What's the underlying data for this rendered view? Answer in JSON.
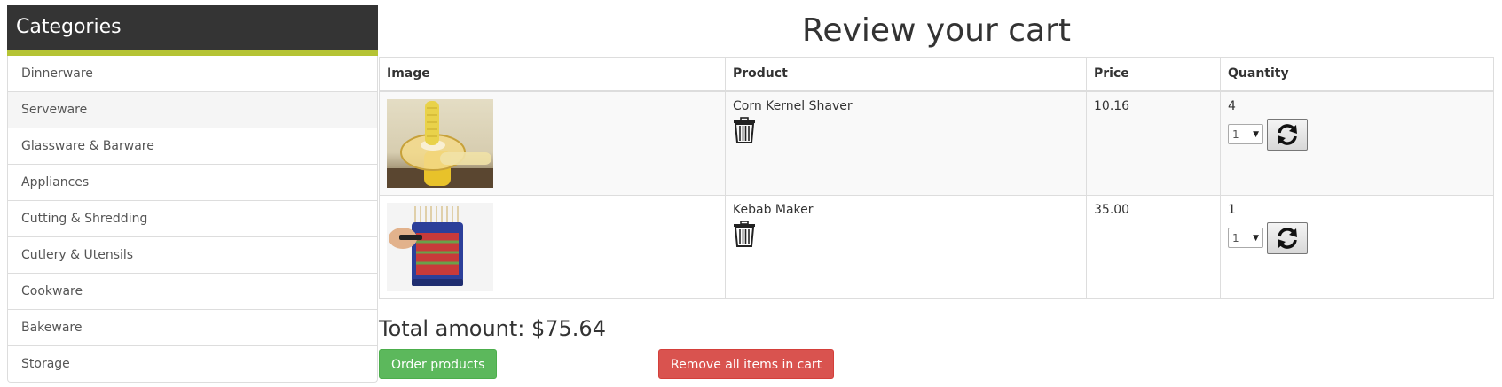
{
  "sidebar": {
    "title": "Categories",
    "items": [
      {
        "label": "Dinnerware"
      },
      {
        "label": "Serveware"
      },
      {
        "label": "Glassware & Barware"
      },
      {
        "label": "Appliances"
      },
      {
        "label": "Cutting & Shredding"
      },
      {
        "label": "Cutlery & Utensils"
      },
      {
        "label": "Cookware"
      },
      {
        "label": "Bakeware"
      },
      {
        "label": "Storage"
      }
    ]
  },
  "main": {
    "title": "Review your cart",
    "table": {
      "headers": {
        "image": "Image",
        "product": "Product",
        "price": "Price",
        "quantity": "Quantity"
      },
      "rows": [
        {
          "product": "Corn Kernel Shaver",
          "price": "10.16",
          "quantity": "4",
          "select_value": "1",
          "image_icon": "corn-kernel-shaver-image"
        },
        {
          "product": "Kebab Maker",
          "price": "35.00",
          "quantity": "1",
          "select_value": "1",
          "image_icon": "kebab-maker-image"
        }
      ]
    },
    "total": "Total amount: $75.64",
    "buttons": {
      "order": "Order products",
      "remove_all": "Remove all items in cart"
    }
  },
  "colors": {
    "sidebar_header_bg": "#343434",
    "sidebar_accent": "#b5c334",
    "order_button": "#5cb85c",
    "remove_button": "#d9534f"
  },
  "icons": {
    "delete": "trash-icon",
    "update": "refresh-icon",
    "dropdown": "caret-down-icon"
  }
}
